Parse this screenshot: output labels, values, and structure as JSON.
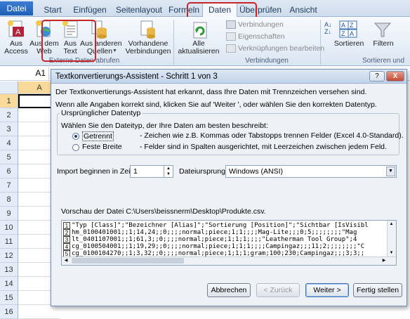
{
  "tabs": [
    "Datei",
    "Start",
    "Einfügen",
    "Seitenlayout",
    "Formeln",
    "Daten",
    "Überprüfen",
    "Ansicht"
  ],
  "ribbon": {
    "aus_access": "Aus\nAccess",
    "aus_web": "Aus dem\nWeb",
    "aus_text": "Aus\nText",
    "aus_anderen": "Aus anderen\nQuellen",
    "vorhandene": "Vorhandene\nVerbindungen",
    "group_extern": "Externe Daten abrufen",
    "alle_aktualisieren": "Alle\naktualisieren",
    "verbindungen": "Verbindungen",
    "eigenschaften": "Eigenschaften",
    "verknuepfungen": "Verknüpfungen bearbeiten",
    "group_verbindungen": "Verbindungen",
    "sortieren": "Sortieren",
    "filtern": "Filtern",
    "group_sort": "Sortieren und"
  },
  "namebox": "A1",
  "grid": {
    "col_a": "A",
    "rows": [
      "1",
      "2",
      "3",
      "4",
      "5",
      "6",
      "7",
      "8",
      "9",
      "10",
      "11",
      "12",
      "13",
      "14",
      "15",
      "16"
    ]
  },
  "dialog": {
    "title": "Textkonvertierungs-Assistent - Schritt 1 von 3",
    "help_btn": "?",
    "close_btn": "X",
    "intro1": "Der Textkonvertierungs-Assistent hat erkannt, dass Ihre Daten mit Trennzeichen versehen sind.",
    "intro2": "Wenn alle Angaben korrekt sind, klicken Sie auf 'Weiter ', oder wählen Sie den korrekten Datentyp.",
    "group_title": "Ursprünglicher Datentyp",
    "group_prompt": "Wählen Sie den Dateityp, der Ihre Daten am besten beschreibt:",
    "radio1_label": "Getrennt",
    "radio1_desc": "- Zeichen wie z.B. Kommas oder Tabstopps trennen Felder (Excel 4.0-Standard).",
    "radio2_label": "Feste Breite",
    "radio2_desc": "- Felder sind in Spalten ausgerichtet, mit Leerzeichen zwischen jedem Feld.",
    "import_label": "Import beginnen in Zeile:",
    "import_value": "1",
    "origin_label": "Dateiursprung:",
    "origin_value": "Windows (ANSI)",
    "preview_label": "Vorschau der Datei C:\\Users\\beissnerm\\Desktop\\Produkte.csv.",
    "preview_lines": [
      {
        "n": "1",
        "t": "\"Typ [Class]\";\"Bezeichner [Alias]\";\"Sortierung [Position]\";\"Sichtbar [IsVisibl"
      },
      {
        "n": "2",
        "t": "hm_0100401001;;1;14,24;;0;;;;normal;piece;1;1;;;;Mag-Lite;;;0;5;;;;;;;;\"Mag"
      },
      {
        "n": "3",
        "t": "lt_0401107001;;1;61,3;;0;;;;normal;piece;1;1;1;;;;\"Leatherman Tool Group\";4"
      },
      {
        "n": "4",
        "t": "cg_0100504001;;1;19,29;;0;;;;normal;piece;1;1;1;;;;Campingaz;;;11;2;;;;;;;;\"C"
      },
      {
        "n": "5",
        "t": "cg_0100104270;;1;3,32;;0;;;;normal;piece;1;1;1;gram;100;230;Campingaz;;;3;3;;"
      }
    ],
    "btn_cancel": "Abbrechen",
    "btn_back": "< Zurück",
    "btn_next": "Weiter >",
    "btn_finish": "Fertig stellen"
  }
}
